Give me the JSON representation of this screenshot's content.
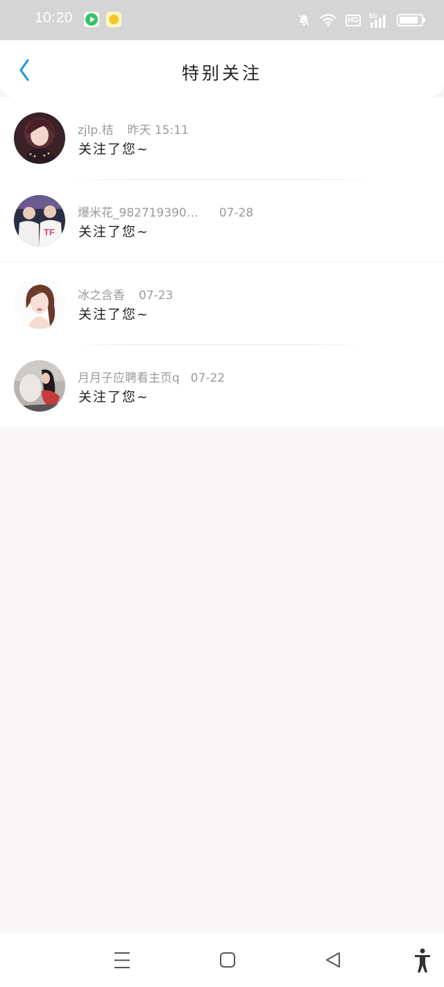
{
  "status_bar": {
    "time": "10:20",
    "icons": [
      "video-app-icon",
      "cup-app-icon",
      "mute-icon",
      "wifi-icon",
      "hd-icon",
      "signal-5g-icon",
      "battery-icon"
    ],
    "hd_label": "HD",
    "network_label": "5G"
  },
  "header": {
    "title": "特别关注",
    "back_icon": "chevron-left-icon",
    "accent_color": "#1a9ae0"
  },
  "notifications": [
    {
      "name": "zjlp.桔",
      "time": "昨天   15:11",
      "message": "关注了您~"
    },
    {
      "name": "爆米花_982719390…",
      "time": "07-28",
      "message": "关注了您~"
    },
    {
      "name": "冰之含香",
      "time": "07-23",
      "message": "关注了您~"
    },
    {
      "name": "月月子应聘看主页q",
      "time": "07-22",
      "message": "关注了您~"
    }
  ],
  "system_nav": {
    "icons": [
      "menu-icon",
      "home-icon",
      "back-icon",
      "accessibility-icon"
    ]
  }
}
